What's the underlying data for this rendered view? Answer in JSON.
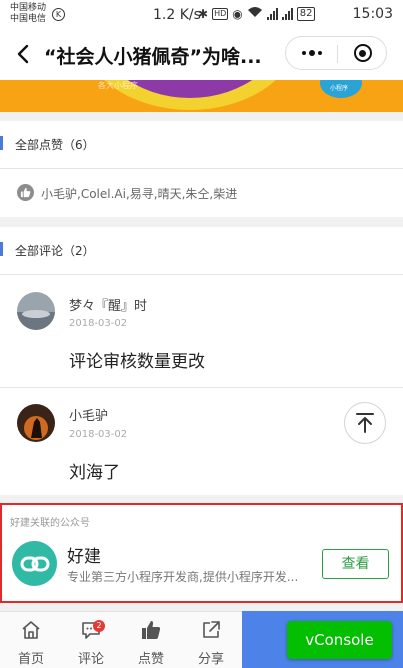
{
  "status_bar": {
    "carrier1": "中国移动",
    "carrier2": "中国电信",
    "network_speed": "1.2 K/s",
    "hd": "HD",
    "battery": "82",
    "time": "15:03"
  },
  "nav": {
    "title": "“社会人小猪佩奇”为啥..."
  },
  "banner": {
    "text": "各大小程序",
    "badge": "小程序"
  },
  "likes": {
    "header": "全部点赞（6）",
    "names": "小毛驴,Colel.Ai,易寻,晴天,朱仝,柴进"
  },
  "comments": {
    "header": "全部评论（2）",
    "items": [
      {
        "name": "梦々『醒』时",
        "date": "2018-03-02",
        "text": "评论审核数量更改"
      },
      {
        "name": "小毛驴",
        "date": "2018-03-02",
        "text": "刘海了"
      }
    ]
  },
  "official_account": {
    "label": "好建关联的公众号",
    "name": "好建",
    "description": "专业第三方小程序开发商,提供小程序开发...",
    "view_button": "查看"
  },
  "tabbar": {
    "items": [
      {
        "label": "首页",
        "icon": "home-icon"
      },
      {
        "label": "评论",
        "icon": "comment-icon",
        "badge": "2"
      },
      {
        "label": "点赞",
        "icon": "thumb-up-icon"
      },
      {
        "label": "分享",
        "icon": "share-icon"
      }
    ],
    "vconsole": "vConsole"
  },
  "colors": {
    "accent_blue": "#4a7bd9",
    "highlight_border": "#e12a2a",
    "view_green": "#2b9d43",
    "vconsole_green": "#04be02",
    "logo_teal": "#30b9a5"
  }
}
